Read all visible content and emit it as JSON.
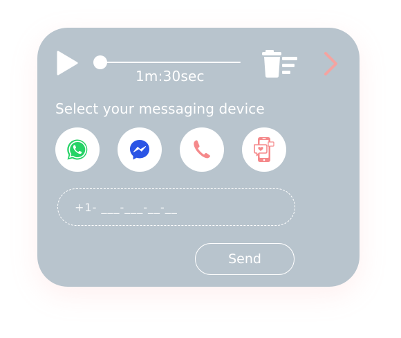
{
  "player": {
    "time_label": "1m:30sec",
    "progress": 0.0,
    "play_icon": "play-icon",
    "delete_icon": "trash-list-icon",
    "next_icon": "chevron-right-icon"
  },
  "devices": {
    "heading": "Select your messaging device",
    "items": [
      {
        "name": "WhatsApp",
        "icon": "whatsapp-icon"
      },
      {
        "name": "Messenger",
        "icon": "messenger-icon"
      },
      {
        "name": "Phone",
        "icon": "phone-icon"
      },
      {
        "name": "Phone message",
        "icon": "phone-message-icon"
      }
    ]
  },
  "phone_input": {
    "placeholder": "+1- ___-___-__-__"
  },
  "actions": {
    "send_label": "Send"
  },
  "colors": {
    "card_background": "#b8c4cd",
    "accent": "#f4a3a0",
    "whatsapp_green": "#25d366",
    "messenger_blue": "#2b55e5",
    "phone_pink": "#f5898b"
  }
}
